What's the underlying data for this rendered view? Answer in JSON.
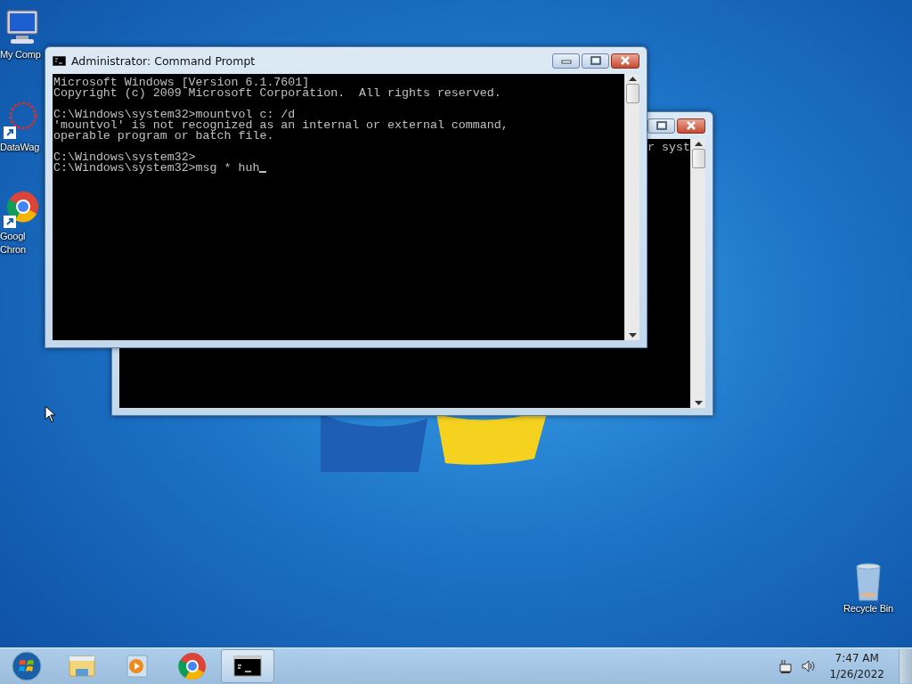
{
  "desktop_icons": [
    {
      "kind": "computer",
      "lines": [
        "My Comp"
      ]
    },
    {
      "kind": "app",
      "lines": [
        "DataWag"
      ]
    },
    {
      "kind": "chrome",
      "lines": [
        "Googl",
        "Chron"
      ]
    },
    {
      "kind": "recycle",
      "lines": [
        "Recycle Bin"
      ]
    }
  ],
  "windows": [
    {
      "console_blocks": [
        [
          "r syst"
        ]
      ]
    },
    {
      "title": "Administrator: Command Prompt",
      "console_blocks": [
        [
          "Microsoft Windows [Version 6.1.7601]",
          "Copyright (c) 2009 Microsoft Corporation.  All rights reserved."
        ],
        [
          "C:\\Windows\\system32>mountvol c: /d",
          "'mountvol' is not recognized as an internal or external command,",
          "operable program or batch file."
        ],
        [
          "C:\\Windows\\system32>",
          "C:\\Windows\\system32>msg * huh"
        ]
      ]
    }
  ],
  "taskbar": {
    "items": [
      {
        "kind": "start",
        "selected": false
      },
      {
        "kind": "explorer",
        "selected": false
      },
      {
        "kind": "media",
        "selected": false
      },
      {
        "kind": "chrome",
        "selected": false
      },
      {
        "kind": "cmd",
        "selected": true
      }
    ],
    "time": "7:47 AM",
    "date": "1/26/2022"
  }
}
